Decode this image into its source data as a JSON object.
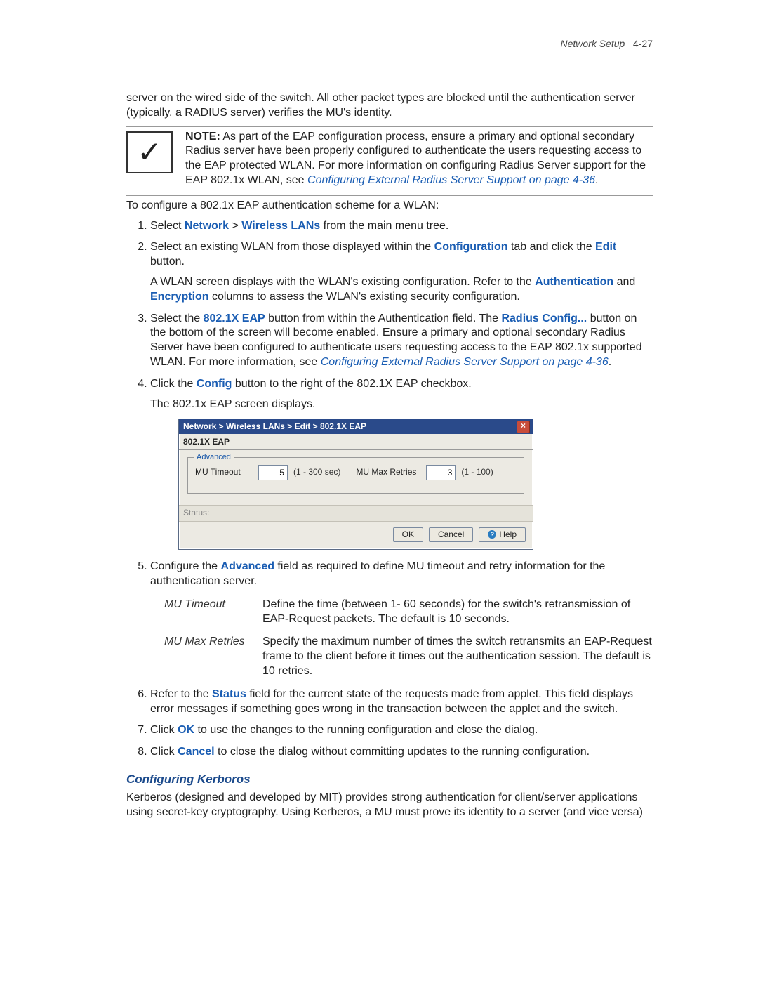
{
  "header": {
    "section": "Network Setup",
    "page": "4-27"
  },
  "intro": "server on the wired side of the switch. All other packet types are blocked until the authentication server (typically, a RADIUS server) verifies the MU's identity.",
  "note": {
    "label": "NOTE:",
    "body": " As part of the EAP configuration process, ensure a primary and optional secondary Radius server have been properly configured to authenticate the users requesting access to the EAP protected WLAN. For more information on configuring Radius Server support for the EAP 802.1x WLAN, see ",
    "link": "Configuring External Radius Server Support on page 4-36",
    "tail": "."
  },
  "lead": "To configure a 802.1x EAP authentication scheme for a WLAN:",
  "steps": {
    "s1": {
      "pre": "Select ",
      "b1": "Network",
      "gt": " > ",
      "b2": "Wireless LANs",
      "post": " from the main menu tree."
    },
    "s2": {
      "line": {
        "pre": "Select an existing WLAN from those displayed within the ",
        "b1": "Configuration",
        "mid": " tab and click the ",
        "b2": "Edit",
        "post": " button."
      },
      "sub": {
        "pre": "A WLAN screen displays with the WLAN's existing configuration. Refer to the ",
        "b1": "Authentication",
        "mid": " and ",
        "b2": "Encryption",
        "post": " columns to assess the WLAN's existing security configuration."
      }
    },
    "s3": {
      "pre": "Select the ",
      "b1": "802.1X EAP",
      "mid1": " button from within the Authentication field. The ",
      "b2": "Radius Config...",
      "mid2": " button on the bottom of the screen will become enabled. Ensure a primary and optional secondary Radius Server have been configured to authenticate users requesting access to the EAP 802.1x supported WLAN. For more information, see ",
      "link": "Configuring External Radius Server Support on page 4-36",
      "post": "."
    },
    "s4": {
      "line": {
        "pre": "Click the ",
        "b1": "Config",
        "post": " button to the right of the 802.1X EAP checkbox."
      },
      "sub": "The 802.1x EAP screen displays."
    },
    "s5": {
      "pre": "Configure the ",
      "b1": "Advanced",
      "post": " field as required to define MU timeout and retry information for the authentication server."
    },
    "s6": {
      "pre": "Refer to the ",
      "b1": "Status",
      "post": " field for the current state of the requests made from applet. This field displays error messages if something goes wrong in the transaction between the applet and the switch."
    },
    "s7": {
      "pre": "Click ",
      "b1": "OK",
      "post": " to use the changes to the running configuration and close the dialog."
    },
    "s8": {
      "pre": "Click ",
      "b1": "Cancel",
      "post": " to close the dialog without committing updates to the running configuration."
    }
  },
  "dialog": {
    "breadcrumb": "Network  >  Wireless LANs  >  Edit  >  802.1X EAP",
    "section_title": "802.1X EAP",
    "fieldset_legend": "Advanced",
    "timeout_label": "MU Timeout",
    "timeout_value": "5",
    "timeout_range": "(1 - 300 sec)",
    "retries_label": "MU Max Retries",
    "retries_value": "3",
    "retries_range": "(1 - 100)",
    "status_label": "Status:",
    "btn_ok": "OK",
    "btn_cancel": "Cancel",
    "btn_help": "Help"
  },
  "defs": {
    "t1": "MU Timeout",
    "d1": "Define the time (between 1- 60 seconds) for the switch's retransmission of EAP-Request packets. The default is 10 seconds.",
    "t2": "MU Max Retries",
    "d2": "Specify the maximum number of times the switch retransmits an EAP-Request frame to the client before it times out the authentication session. The default is 10 retries."
  },
  "subheading": "Configuring Kerboros",
  "kerb_para": "Kerberos (designed and developed by MIT) provides strong authentication for client/server applications using secret-key cryptography. Using Kerberos, a MU must prove its identity to a server (and vice versa)"
}
